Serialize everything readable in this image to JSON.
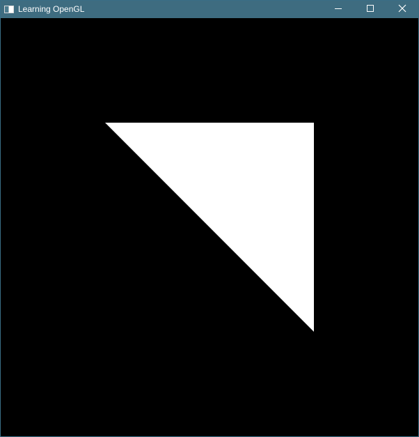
{
  "window": {
    "title": "Learning OpenGL",
    "title_bar_color": "#3e6c80",
    "app_icon": "window-app-icon"
  },
  "controls": {
    "minimize": "minimize-icon",
    "maximize": "maximize-icon",
    "close": "close-icon"
  },
  "canvas": {
    "clear_color": "#000000",
    "shape": "triangle",
    "fill_color": "#ffffff"
  }
}
